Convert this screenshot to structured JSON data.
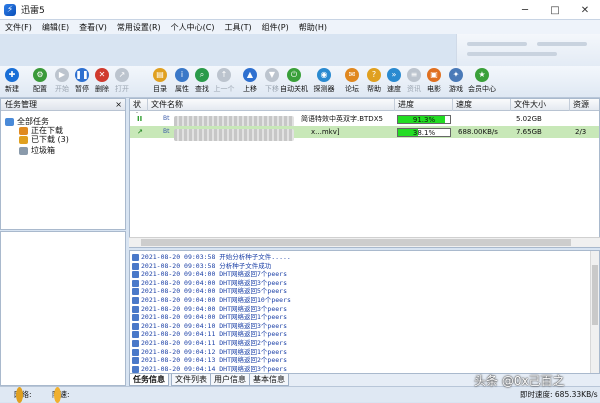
{
  "window": {
    "title": "迅雷5"
  },
  "menu": [
    "文件(F)",
    "编辑(E)",
    "查看(V)",
    "常用设置(R)",
    "个人中心(C)",
    "工具(T)",
    "组件(P)",
    "帮助(H)"
  ],
  "toolbar": [
    {
      "label": "新建",
      "icon": "new-task-icon",
      "color": "#1a6fd6",
      "enabled": true
    },
    {
      "label": "配置",
      "icon": "config-icon",
      "color": "#3a9a3a",
      "enabled": true
    },
    {
      "label": "开始",
      "icon": "start-icon",
      "color": "#8e9aa8",
      "enabled": false
    },
    {
      "label": "暂停",
      "icon": "pause-icon",
      "color": "#2e70d0",
      "enabled": true
    },
    {
      "label": "删除",
      "icon": "delete-icon",
      "color": "#d03a2e",
      "enabled": true
    },
    {
      "label": "打开",
      "icon": "open-icon",
      "color": "#8e9aa8",
      "enabled": false
    },
    {
      "label": "目录",
      "icon": "folder-icon",
      "color": "#e0a020",
      "enabled": true
    },
    {
      "label": "属性",
      "icon": "properties-icon",
      "color": "#3a78c8",
      "enabled": true
    },
    {
      "label": "查找",
      "icon": "search-icon",
      "color": "#2a9a4a",
      "enabled": true
    },
    {
      "label": "上一个",
      "icon": "up-icon",
      "color": "#8e9aa8",
      "enabled": false
    },
    {
      "label": "上移",
      "icon": "move-up-icon",
      "color": "#2e70d0",
      "enabled": true
    },
    {
      "label": "下移",
      "icon": "move-down-icon",
      "color": "#8e9aa8",
      "enabled": false
    },
    {
      "label": "自动关机",
      "icon": "shutdown-icon",
      "color": "#3aa03a",
      "enabled": true
    },
    {
      "label": "探测器",
      "icon": "detector-icon",
      "color": "#2a8ad0",
      "enabled": true
    },
    {
      "label": "论坛",
      "icon": "forum-icon",
      "color": "#e08820",
      "enabled": true
    },
    {
      "label": "帮助",
      "icon": "help-icon",
      "color": "#e0a020",
      "enabled": true
    },
    {
      "label": "速度",
      "icon": "speed-icon",
      "color": "#2a8ad0",
      "enabled": true
    },
    {
      "label": "资讯",
      "icon": "news-icon",
      "color": "#8e9aa8",
      "enabled": false
    },
    {
      "label": "电影",
      "icon": "movie-icon",
      "color": "#e07020",
      "enabled": true
    },
    {
      "label": "游戏",
      "icon": "game-icon",
      "color": "#4a7ab8",
      "enabled": true
    },
    {
      "label": "会员中心",
      "icon": "vip-icon",
      "color": "#3aa03a",
      "enabled": true
    }
  ],
  "task_panel": {
    "title": "任务管理",
    "close": "×",
    "tree": [
      {
        "label": "全部任务",
        "icon": "all-tasks-icon",
        "color": "#4a8ad8"
      },
      {
        "label": "正在下载",
        "icon": "downloading-icon",
        "color": "#e08a20"
      },
      {
        "label": "已下载 (3)",
        "icon": "downloaded-icon",
        "color": "#e0a020"
      },
      {
        "label": "垃圾箱",
        "icon": "trash-icon",
        "color": "#8a9aab"
      }
    ]
  },
  "task_list": {
    "columns": [
      "状态",
      "文件名称",
      "进度",
      "速度",
      "文件大小",
      "资源"
    ],
    "rows": [
      {
        "status_icon": "pause-status-icon",
        "status": "II",
        "filename_visible": "简语特效中英双字.BTDX5",
        "progress": 91.3,
        "progress_text": "91.3%",
        "speed": "",
        "size": "5.02GB",
        "resources": ""
      },
      {
        "status_icon": "running-status-icon",
        "status": "↗",
        "filename_visible": "x...mkv]",
        "progress": 38.1,
        "progress_text": "38.1%",
        "speed": "688.00KB/s",
        "size": "7.65GB",
        "resources": "2/3"
      }
    ]
  },
  "log": [
    "2021-08-20 09:03:58 开始分析种子文件.....",
    "2021-08-20 09:03:58 分析种子文件成功",
    "2021-08-20 09:04:00 DHT网络返回7个peers",
    "2021-08-20 09:04:00 DHT网络返回3个peers",
    "2021-08-20 09:04:00 DHT网络返回5个peers",
    "2021-08-20 09:04:00 DHT网络返回10个peers",
    "2021-08-20 09:04:00 DHT网络返回3个peers",
    "2021-08-20 09:04:00 DHT网络返回1个peers",
    "2021-08-20 09:04:10 DHT网络返回3个peers",
    "2021-08-20 09:04:11 DHT网络返回1个peers",
    "2021-08-20 09:04:11 DHT网络返回2个peers",
    "2021-08-20 09:04:12 DHT网络返回1个peers",
    "2021-08-20 09:04:13 DHT网络返回2个peers",
    "2021-08-20 09:04:14 DHT网络返回3个peers"
  ],
  "tabs": [
    "任务信息",
    "文件列表",
    "用户信息",
    "基本信息"
  ],
  "status": {
    "network_label": "网络:",
    "network_color": "#e0a020",
    "limit_label": "限速:",
    "speed_label": "即时速度: 685.33KB/s"
  },
  "watermark": "头条 @0x己百之"
}
